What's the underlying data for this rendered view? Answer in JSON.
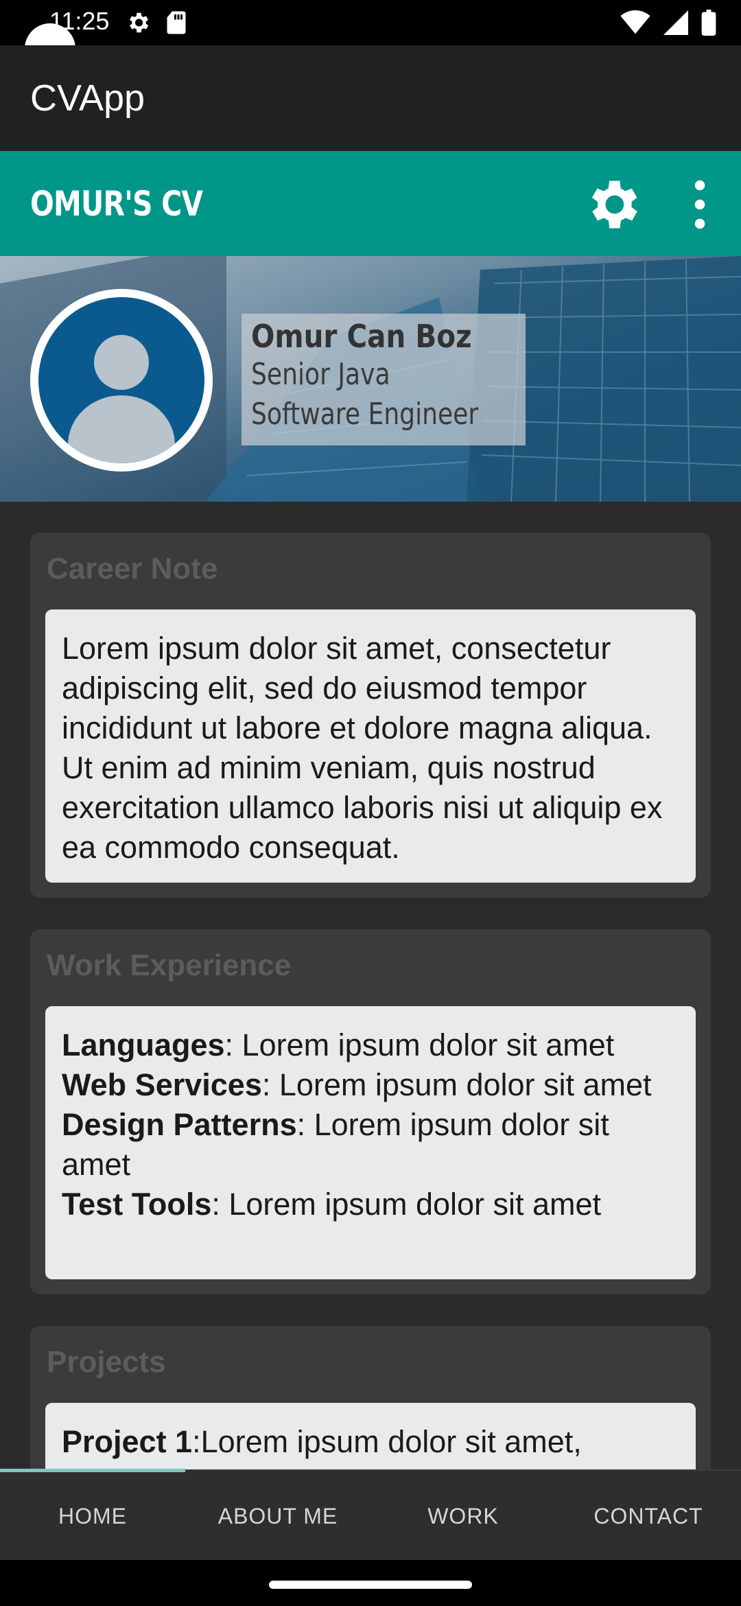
{
  "status_bar": {
    "time": "11:25"
  },
  "app": {
    "title": "CVApp"
  },
  "toolbar": {
    "title": "OMUR'S CV"
  },
  "profile": {
    "name": "Omur Can Boz",
    "role_line1": "Senior Java",
    "role_line2": "Software Engineer"
  },
  "career": {
    "title": "Career Note",
    "text": "Lorem ipsum dolor sit amet, consectetur adipiscing elit, sed do eiusmod tempor incididunt ut labore et dolore magna aliqua. Ut enim ad minim veniam, quis nostrud exercitation ullamco laboris nisi ut aliquip ex ea commodo consequat."
  },
  "work": {
    "title": "Work Experience",
    "items": [
      {
        "label": "Languages",
        "text": ": Lorem ipsum dolor sit amet"
      },
      {
        "label": "Web Services",
        "text": ": Lorem ipsum dolor sit amet"
      },
      {
        "label": "Design Patterns",
        "text": ": Lorem ipsum dolor sit amet"
      },
      {
        "label": "Test Tools",
        "text": ": Lorem ipsum dolor sit amet"
      }
    ]
  },
  "projects": {
    "title": "Projects",
    "items": [
      {
        "label": "Project 1",
        "text": ":Lorem ipsum dolor sit amet,"
      }
    ]
  },
  "bottom_nav": {
    "items": [
      {
        "label": "HOME"
      },
      {
        "label": "ABOUT ME"
      },
      {
        "label": "WORK"
      },
      {
        "label": "CONTACT"
      }
    ],
    "selected_index": 0
  },
  "colors": {
    "toolbar": "#009688",
    "app_bar": "#212121",
    "background": "#2b2b2b",
    "card": "#3b3b3b",
    "card_body": "#e9eaec",
    "avatar": "#0a5a8f",
    "nav_indicator": "#7fc7bf"
  },
  "icons": {
    "settings": "gear-icon",
    "overflow": "more-vertical-icon",
    "status_left": [
      "gear-icon",
      "sd-card-icon"
    ],
    "status_right": [
      "wifi-icon",
      "signal-icon",
      "battery-icon"
    ]
  }
}
